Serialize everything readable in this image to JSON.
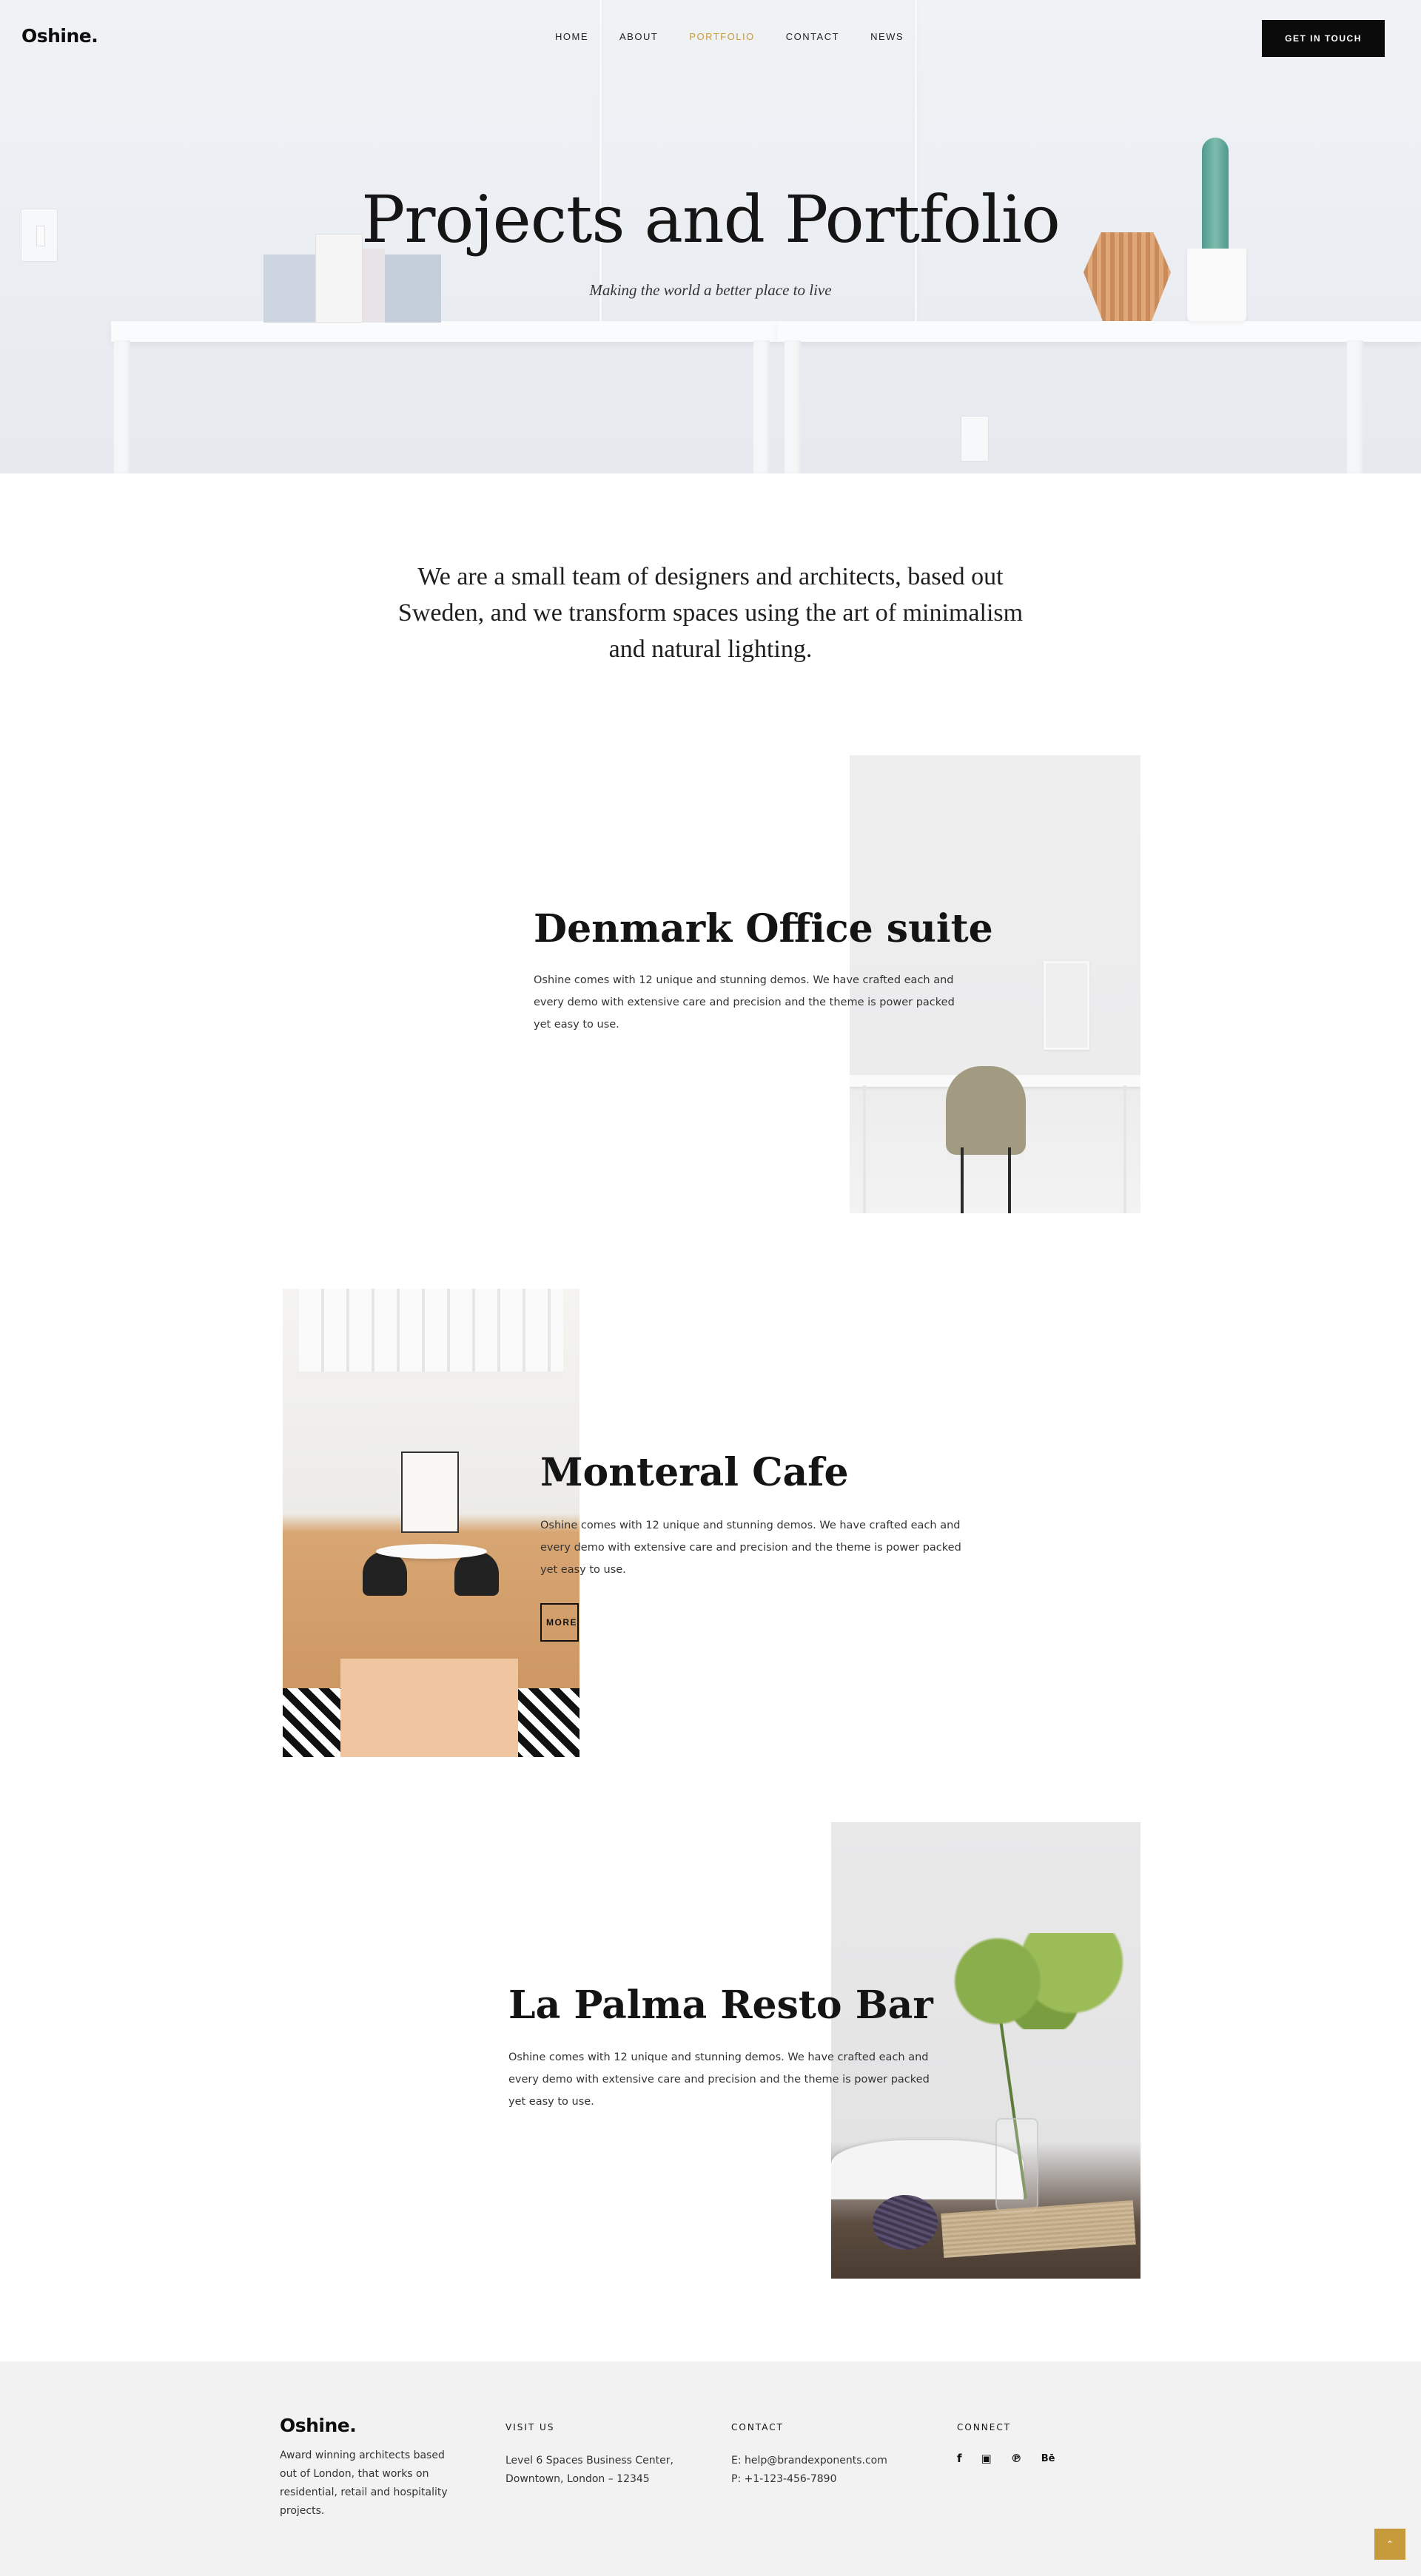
{
  "header": {
    "logo": "Oshine.",
    "nav": [
      {
        "label": "HOME",
        "active": false
      },
      {
        "label": "ABOUT",
        "active": false
      },
      {
        "label": "PORTFOLIO",
        "active": true
      },
      {
        "label": "CONTACT",
        "active": false
      },
      {
        "label": "NEWS",
        "active": false
      }
    ],
    "cta_label": "GET IN TOUCH"
  },
  "hero": {
    "title": "Projects and Portfolio",
    "subtitle": "Making the world a better place to live"
  },
  "intro": {
    "text": "We are a small team of designers and architects, based out Sweden, and we transform spaces using the art of minimalism and natural lighting."
  },
  "projects": [
    {
      "title": "Denmark Office suite",
      "description": "Oshine comes with 12 unique and stunning demos. We have crafted each and every demo with extensive care and precision and the theme is power packed yet easy to use."
    },
    {
      "title": "Monteral Cafe",
      "description": "Oshine comes with 12 unique and stunning demos. We have crafted each and every demo with extensive care and precision and the theme is power packed yet easy to use.",
      "button_label": "LEARN MORE"
    },
    {
      "title": "La Palma Resto Bar",
      "description": "Oshine comes with 12 unique and stunning demos. We have crafted each and every demo with extensive care and precision and the theme is power packed yet easy to use."
    }
  ],
  "footer": {
    "logo": "Oshine.",
    "about": "Award winning architects based out of London, that works on residential, retail and hospitality projects.",
    "visit_heading": "VISIT US",
    "visit_line1": "Level 6 Spaces Business Center,",
    "visit_line2": "Downtown, London – 12345",
    "contact_heading": "CONTACT",
    "contact_email": "E: help@brandexponents.com",
    "contact_phone": "P: +1-123-456-7890",
    "connect_heading": "CONNECT",
    "social_icons": [
      "facebook-icon",
      "instagram-icon",
      "pinterest-icon",
      "behance-icon"
    ]
  },
  "colors": {
    "accent": "#c79a3b",
    "cta_bg": "#0b0b0b",
    "footer_bg": "#f2f2f2"
  }
}
